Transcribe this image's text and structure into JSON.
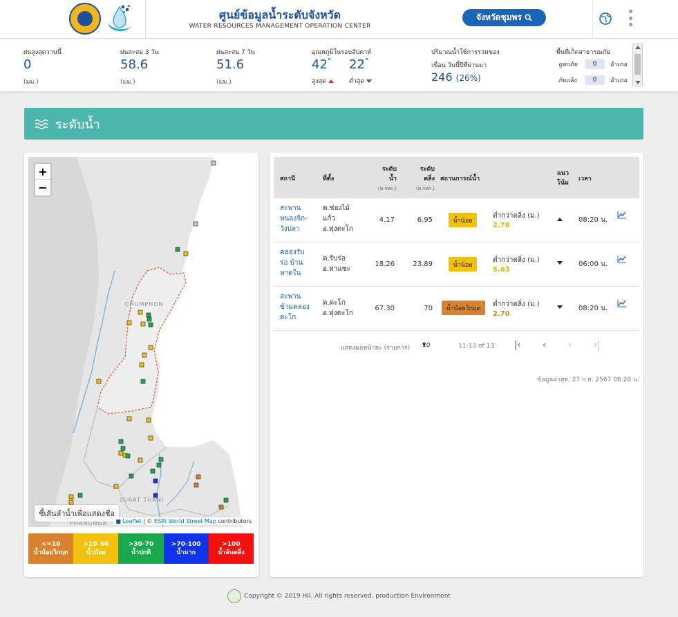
{
  "header": {
    "title": "ศูนย์ข้อมูลน้ำระดับจังหวัด",
    "subtitle": "WATER RESOURCES MANAGEMENT OPERATION CENTER",
    "province_button": "จังหวัดชุมพร"
  },
  "stats": {
    "rain_today": {
      "label": "ฝนสูงสุดวานนี้",
      "value": "0",
      "unit": "(มม.)"
    },
    "rain_3day": {
      "label": "ฝนสะสม 3 วัน",
      "value": "58.6",
      "unit": "(มม.)"
    },
    "rain_7day": {
      "label": "ฝนสะสม 7 วัน",
      "value": "51.6",
      "unit": "(มม.)"
    },
    "temp": {
      "label": "อุณหภูมิในรอบสัปดาห์",
      "high": "42",
      "low": "22",
      "degree": "°",
      "high_label": "สูงสุด",
      "low_label": "ต่ำสุด"
    },
    "dam": {
      "label1": "ปริมาณน้ำใช้การรวมของ",
      "label2": "เขื่อน วันนี้ปีที่ผ่านมา",
      "value": "246",
      "percent": "(26%)"
    },
    "disaster": {
      "label": "พื้นที่เกิดสาธารณภัย",
      "rows": [
        {
          "name": "อุทกภัย",
          "count": "0",
          "unit": "อำเภอ"
        },
        {
          "name": "ภัยแล้ง",
          "count": "0",
          "unit": "อำเภอ"
        }
      ]
    }
  },
  "section": {
    "title": "ระดับน้ำ"
  },
  "map": {
    "zoom_in": "+",
    "zoom_out": "−",
    "region_label_1": "CHUMPHON",
    "region_label_2": "SURAT THANI",
    "region_label_3": "PHANGNGA",
    "hint": "ชี้เส้นลำน้ำเพื่อแสดงชื่อ",
    "attrib_leaflet": "Leaflet",
    "attrib_sep": " | © ",
    "attrib_esri": "ESRI World Street Map",
    "attrib_contrib": " contributors",
    "legend": [
      {
        "range": "<=10",
        "label": "น้ำน้อยวิกฤต",
        "color": "#d9822b"
      },
      {
        "range": ">10-30",
        "label": "น้ำน้อย",
        "color": "#f2c10d"
      },
      {
        "range": ">30-70",
        "label": "น้ำปกติ",
        "color": "#1aa84c"
      },
      {
        "range": ">70-100",
        "label": "น้ำมาก",
        "color": "#0f33e8"
      },
      {
        "range": ">100",
        "label": "น้ำล้นตลิ่ง",
        "color": "#f50f0f"
      }
    ]
  },
  "table": {
    "headers": {
      "station": "สถานี",
      "location": "ที่ตั้ง",
      "level": "ระดับ",
      "level2": "น้ำ",
      "level_unit": "(ม.รทก.)",
      "bank": "ระดับ",
      "bank2": "ตลิ่ง",
      "bank_unit": "(ม.รทก.)",
      "situation": "สถานการณ์น้ำ",
      "trend": "แนว",
      "trend2": "โน้ม",
      "time": "เวลา"
    },
    "rows": [
      {
        "station": [
          "สะพาน",
          "หนองจิก-",
          "วังปลา"
        ],
        "location": [
          "ต.ช่องไม้",
          "แก้ว",
          "อ.ทุ่งตะโก"
        ],
        "level": "4.17",
        "bank": "6.95",
        "status": "น้ำน้อย",
        "status_color": "#f2c10d",
        "diff_label": "ต่ำกว่าตลิ่ง (ม.)",
        "diff": "2.78",
        "diff_color": "#e0b21a",
        "trend": "up",
        "time": "08:20 น."
      },
      {
        "station": [
          "คลองรับ",
          "ร่อ บ้าน",
          "หาดใน"
        ],
        "location": [
          "ต.รับร่อ",
          "อ.ท่าแซะ"
        ],
        "level": "18.26",
        "bank": "23.89",
        "status": "น้ำน้อย",
        "status_color": "#f2c10d",
        "diff_label": "ต่ำกว่าตลิ่ง (ม.)",
        "diff": "5.63",
        "diff_color": "#e0b21a",
        "trend": "down",
        "time": "06:00 น."
      },
      {
        "station": [
          "สะพาน",
          "ข้ามคลอง",
          "ตะโก"
        ],
        "location": [
          "ต.ตะโก",
          "อ.ทุ่งตะโก"
        ],
        "level": "67.30",
        "bank": "70",
        "status": "น้ำน้อยวิกฤต",
        "status_color": "#d9822b",
        "diff_label": "ต่ำกว่าตลิ่ง (ม.)",
        "diff": "2.70",
        "diff_color": "#c88a2a",
        "trend": "down",
        "time": "08:20 น."
      }
    ],
    "pager": {
      "per_page_label": "แสดงผลหน้าละ (รายการ)",
      "per_page": "10",
      "range": "11-13 of 13"
    },
    "updated": "ข้อมูลล่าสุด, 27 ก.ย. 2567 08:20 น."
  },
  "footer": {
    "text": "Copyright © 2019 HII. All rights reserved. production Environment"
  }
}
